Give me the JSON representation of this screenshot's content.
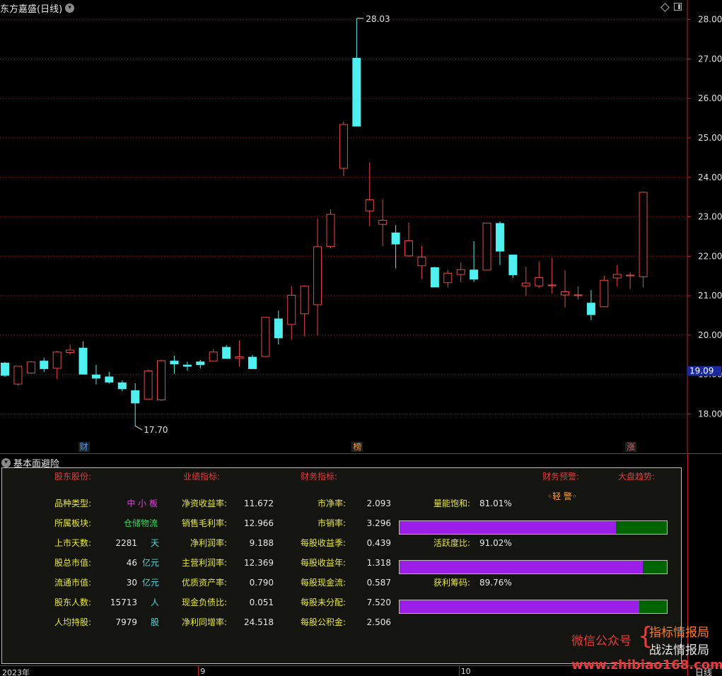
{
  "window": {
    "title": "东方嘉盛(日线)",
    "lower_title": "基本面避险",
    "mode": "日线"
  },
  "colors": {
    "up": "#e84848",
    "down": "#50f0f0",
    "grid": "#8a1a1a",
    "axis": "#c02020",
    "price_tag_bg": "#1a2a9a"
  },
  "chart_data": {
    "type": "candlestick",
    "y_axis": {
      "min": 17.7,
      "max": 28.25,
      "ticks": [
        18.0,
        19.0,
        20.0,
        21.0,
        22.0,
        23.0,
        24.0,
        25.0,
        26.0,
        27.0,
        28.0
      ]
    },
    "current_price": "19.09",
    "high_label": "28.03",
    "low_label": "17.70",
    "date_labels": [
      {
        "text": "2023年",
        "index": 0
      },
      {
        "text": "9",
        "index": 15
      },
      {
        "text": "10",
        "index": 35
      }
    ],
    "badges": [
      {
        "text": "财",
        "index": 6,
        "color": "#4aa0ff"
      },
      {
        "text": "榜",
        "index": 27,
        "color": "#ffa030"
      },
      {
        "text": "涨",
        "index": 48,
        "color": "#ff5050"
      }
    ],
    "candles": [
      {
        "o": 19.3,
        "h": 19.32,
        "l": 18.94,
        "c": 18.97
      },
      {
        "o": 18.75,
        "h": 19.22,
        "l": 18.72,
        "c": 19.22
      },
      {
        "o": 19.03,
        "h": 19.34,
        "l": 19.02,
        "c": 19.33
      },
      {
        "o": 19.35,
        "h": 19.42,
        "l": 19.06,
        "c": 19.14
      },
      {
        "o": 19.15,
        "h": 19.6,
        "l": 18.88,
        "c": 19.58
      },
      {
        "o": 19.55,
        "h": 19.76,
        "l": 19.5,
        "c": 19.63
      },
      {
        "o": 19.68,
        "h": 19.84,
        "l": 19.07,
        "c": 19.0
      },
      {
        "o": 19.0,
        "h": 19.25,
        "l": 18.75,
        "c": 18.9
      },
      {
        "o": 18.95,
        "h": 19.07,
        "l": 18.77,
        "c": 18.8
      },
      {
        "o": 18.8,
        "h": 18.85,
        "l": 18.58,
        "c": 18.63
      },
      {
        "o": 18.6,
        "h": 18.78,
        "l": 17.7,
        "c": 18.27
      },
      {
        "o": 18.37,
        "h": 19.12,
        "l": 18.37,
        "c": 19.1
      },
      {
        "o": 18.35,
        "h": 19.38,
        "l": 18.33,
        "c": 19.36
      },
      {
        "o": 19.35,
        "h": 19.48,
        "l": 19.02,
        "c": 19.26
      },
      {
        "o": 19.25,
        "h": 19.32,
        "l": 19.1,
        "c": 19.2
      },
      {
        "o": 19.33,
        "h": 19.37,
        "l": 19.16,
        "c": 19.24
      },
      {
        "o": 19.33,
        "h": 19.65,
        "l": 19.33,
        "c": 19.58
      },
      {
        "o": 19.7,
        "h": 19.75,
        "l": 19.4,
        "c": 19.4
      },
      {
        "o": 19.4,
        "h": 19.86,
        "l": 19.21,
        "c": 19.46
      },
      {
        "o": 19.45,
        "h": 19.5,
        "l": 19.14,
        "c": 19.14
      },
      {
        "o": 19.45,
        "h": 20.46,
        "l": 19.45,
        "c": 20.46
      },
      {
        "o": 20.42,
        "h": 20.62,
        "l": 19.76,
        "c": 19.92
      },
      {
        "o": 20.26,
        "h": 21.24,
        "l": 19.88,
        "c": 21.02
      },
      {
        "o": 20.53,
        "h": 21.26,
        "l": 19.97,
        "c": 21.25
      },
      {
        "o": 20.76,
        "h": 22.95,
        "l": 19.99,
        "c": 22.25
      },
      {
        "o": 22.24,
        "h": 23.19,
        "l": 22.2,
        "c": 23.07
      },
      {
        "o": 24.22,
        "h": 25.42,
        "l": 24.03,
        "c": 25.35
      },
      {
        "o": 27.03,
        "h": 28.03,
        "l": 25.29,
        "c": 25.29
      },
      {
        "o": 23.14,
        "h": 24.38,
        "l": 22.76,
        "c": 23.44
      },
      {
        "o": 22.8,
        "h": 23.44,
        "l": 22.25,
        "c": 22.92
      },
      {
        "o": 22.6,
        "h": 22.79,
        "l": 21.69,
        "c": 22.3
      },
      {
        "o": 22.0,
        "h": 22.85,
        "l": 21.99,
        "c": 22.4
      },
      {
        "o": 21.75,
        "h": 22.26,
        "l": 21.42,
        "c": 21.99
      },
      {
        "o": 21.72,
        "h": 21.73,
        "l": 21.22,
        "c": 21.21
      },
      {
        "o": 21.32,
        "h": 21.65,
        "l": 21.21,
        "c": 21.58
      },
      {
        "o": 21.53,
        "h": 21.84,
        "l": 21.34,
        "c": 21.67
      },
      {
        "o": 21.66,
        "h": 22.38,
        "l": 21.35,
        "c": 21.41
      },
      {
        "o": 21.64,
        "h": 22.85,
        "l": 21.64,
        "c": 22.85
      },
      {
        "o": 22.84,
        "h": 22.88,
        "l": 21.78,
        "c": 22.12
      },
      {
        "o": 22.04,
        "h": 22.03,
        "l": 21.45,
        "c": 21.52
      },
      {
        "o": 21.24,
        "h": 21.73,
        "l": 21.0,
        "c": 21.33
      },
      {
        "o": 21.24,
        "h": 21.86,
        "l": 21.19,
        "c": 21.47
      },
      {
        "o": 21.27,
        "h": 21.96,
        "l": 21.06,
        "c": 21.28
      },
      {
        "o": 21.01,
        "h": 21.65,
        "l": 20.7,
        "c": 21.11
      },
      {
        "o": 21.01,
        "h": 21.24,
        "l": 20.9,
        "c": 21.03
      },
      {
        "o": 20.82,
        "h": 21.14,
        "l": 20.38,
        "c": 20.51
      },
      {
        "o": 20.71,
        "h": 21.51,
        "l": 20.71,
        "c": 21.4
      },
      {
        "o": 21.44,
        "h": 21.78,
        "l": 21.23,
        "c": 21.55
      },
      {
        "o": 21.51,
        "h": 21.6,
        "l": 21.17,
        "c": 21.53
      },
      {
        "o": 21.47,
        "h": 23.64,
        "l": 21.21,
        "c": 23.63
      }
    ]
  },
  "fundamentals": {
    "headers": [
      "股东股份:",
      "业绩指标:",
      "财务指标:",
      "财务预警:",
      "大盘趋势:"
    ],
    "col1": [
      {
        "label": "品种类型:",
        "value": "中 小 板",
        "unit": ""
      },
      {
        "label": "所属板块:",
        "value": "仓储物流",
        "unit": ""
      },
      {
        "label": "上市天数:",
        "value": "2281",
        "unit": "天"
      },
      {
        "label": "股总市值:",
        "value": "46",
        "unit": "亿元"
      },
      {
        "label": "流通市值:",
        "value": "30",
        "unit": "亿元"
      },
      {
        "label": "股东人数:",
        "value": "15713",
        "unit": "人"
      },
      {
        "label": "人均持股:",
        "value": "7979",
        "unit": "股"
      }
    ],
    "col2": [
      {
        "label": "净资收益率:",
        "value": "11.672"
      },
      {
        "label": "销售毛利率:",
        "value": "12.966"
      },
      {
        "label": "净利润率:",
        "value": "9.188"
      },
      {
        "label": "主营利润率:",
        "value": "12.369"
      },
      {
        "label": "优质资产率:",
        "value": "0.790"
      },
      {
        "label": "现金负债比:",
        "value": "0.051"
      },
      {
        "label": "净利同增率:",
        "value": "24.518"
      }
    ],
    "col3": [
      {
        "label": "市净率:",
        "value": "2.093"
      },
      {
        "label": "市销率:",
        "value": "3.296"
      },
      {
        "label": "每股收益季:",
        "value": "0.439"
      },
      {
        "label": "每股收益年:",
        "value": "1.318"
      },
      {
        "label": "每股现金流:",
        "value": "0.587"
      },
      {
        "label": "每股未分配:",
        "value": "7.520"
      },
      {
        "label": "每股公积金:",
        "value": "2.506"
      }
    ],
    "warning": "◦轻 警◦",
    "metrics": [
      {
        "label": "量能饱和:",
        "value": "81.01%",
        "fraction": 0.8101
      },
      {
        "label": "活跃度比:",
        "value": "91.02%",
        "fraction": 0.9102
      },
      {
        "label": "获利筹码:",
        "value": "89.76%",
        "fraction": 0.8976
      }
    ]
  },
  "watermark": {
    "left": "微信公众号",
    "brace": "{",
    "line1": "指标情报局",
    "line2": "战法情报局",
    "url": "www.zhibiao168.com"
  }
}
